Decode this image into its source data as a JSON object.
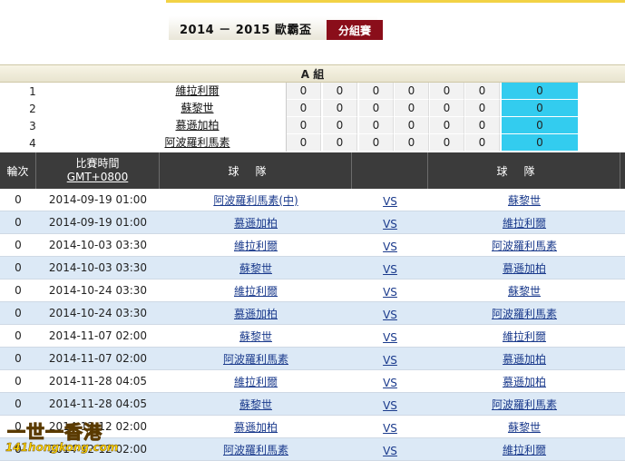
{
  "title": "2014 － 2015 歐霸盃",
  "group_button": "分組賽",
  "group_name": "A 組",
  "standings": [
    {
      "rank": "1",
      "team": "維拉利爾",
      "stats": [
        "0",
        "0",
        "0",
        "0",
        "0",
        "0"
      ],
      "points": "0"
    },
    {
      "rank": "2",
      "team": "蘇黎世",
      "stats": [
        "0",
        "0",
        "0",
        "0",
        "0",
        "0"
      ],
      "points": "0"
    },
    {
      "rank": "3",
      "team": "慕遜加柏",
      "stats": [
        "0",
        "0",
        "0",
        "0",
        "0",
        "0"
      ],
      "points": "0"
    },
    {
      "rank": "4",
      "team": "阿波羅利馬素",
      "stats": [
        "0",
        "0",
        "0",
        "0",
        "0",
        "0"
      ],
      "points": "0"
    }
  ],
  "matches_header": {
    "round": "輪次",
    "time_line1": "比賽時間",
    "time_line2": "GMT+0800",
    "home": "球隊",
    "vs": "",
    "away": "球隊"
  },
  "matches": [
    {
      "round": "0",
      "time": "2014-09-19 01:00",
      "home": "阿波羅利馬素(中)",
      "vs": "VS",
      "away": "蘇黎世"
    },
    {
      "round": "0",
      "time": "2014-09-19 01:00",
      "home": "慕遜加柏",
      "vs": "VS",
      "away": "維拉利爾"
    },
    {
      "round": "0",
      "time": "2014-10-03 03:30",
      "home": "維拉利爾",
      "vs": "VS",
      "away": "阿波羅利馬素"
    },
    {
      "round": "0",
      "time": "2014-10-03 03:30",
      "home": "蘇黎世",
      "vs": "VS",
      "away": "慕遜加柏"
    },
    {
      "round": "0",
      "time": "2014-10-24 03:30",
      "home": "維拉利爾",
      "vs": "VS",
      "away": "蘇黎世"
    },
    {
      "round": "0",
      "time": "2014-10-24 03:30",
      "home": "慕遜加柏",
      "vs": "VS",
      "away": "阿波羅利馬素"
    },
    {
      "round": "0",
      "time": "2014-11-07 02:00",
      "home": "蘇黎世",
      "vs": "VS",
      "away": "維拉利爾"
    },
    {
      "round": "0",
      "time": "2014-11-07 02:00",
      "home": "阿波羅利馬素",
      "vs": "VS",
      "away": "慕遜加柏"
    },
    {
      "round": "0",
      "time": "2014-11-28 04:05",
      "home": "維拉利爾",
      "vs": "VS",
      "away": "慕遜加柏"
    },
    {
      "round": "0",
      "time": "2014-11-28 04:05",
      "home": "蘇黎世",
      "vs": "VS",
      "away": "阿波羅利馬素"
    },
    {
      "round": "0",
      "time": "2014-12-12 02:00",
      "home": "慕遜加柏",
      "vs": "VS",
      "away": "蘇黎世"
    },
    {
      "round": "0",
      "time": "2014-12-12 02:00",
      "home": "阿波羅利馬素",
      "vs": "VS",
      "away": "維拉利爾"
    }
  ],
  "watermark": {
    "line1": "一世一香港",
    "line2": "141hongkong.com"
  }
}
